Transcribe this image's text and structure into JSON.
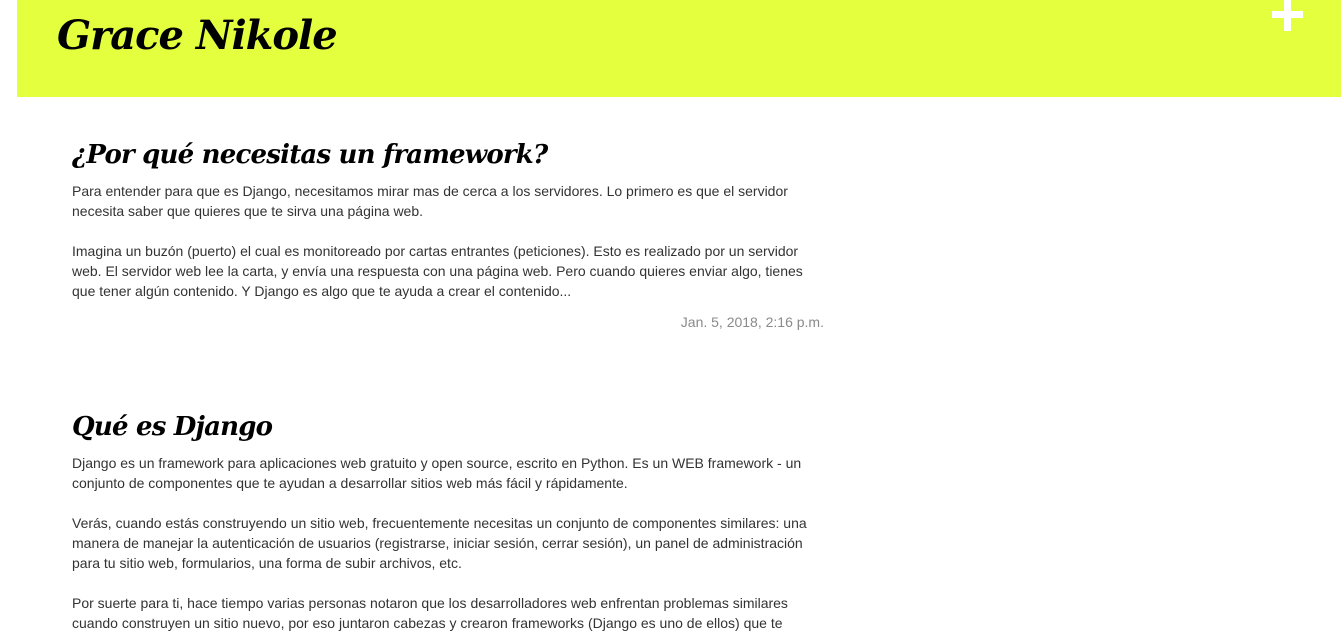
{
  "header": {
    "site_title": "Grace Nikole",
    "add_icon": "plus-icon",
    "background_color": "#e3ff3e"
  },
  "posts": [
    {
      "title": "¿Por qué necesitas un framework?",
      "paragraphs": [
        "Para entender para que es Django, necesitamos mirar mas de cerca a los servidores. Lo primero es que el servidor necesita saber que quieres que te sirva una página web.",
        "Imagina un buzón (puerto) el cual es monitoreado por cartas entrantes (peticiones). Esto es realizado por un servidor web. El servidor web lee la carta, y envía una respuesta con una página web. Pero cuando quieres enviar algo, tienes que tener algún contenido. Y Django es algo que te ayuda a crear el contenido..."
      ],
      "date": "Jan. 5, 2018, 2:16 p.m."
    },
    {
      "title": "Qué es Django",
      "paragraphs": [
        "Django es un framework para aplicaciones web gratuito y open source, escrito en Python. Es un WEB framework - un conjunto de componentes que te ayudan a desarrollar sitios web más fácil y rápidamente.",
        "Verás, cuando estás construyendo un sitio web, frecuentemente necesitas un conjunto de componentes similares: una manera de manejar la autenticación de usuarios (registrarse, iniciar sesión, cerrar sesión), un panel de administración para tu sitio web, formularios, una forma de subir archivos, etc.",
        "Por suerte para ti, hace tiempo varias personas notaron que los desarrolladores web enfrentan problemas similares cuando construyen un sitio nuevo, por eso juntaron cabezas y crearon frameworks (Django es uno de ellos) que te"
      ]
    }
  ]
}
